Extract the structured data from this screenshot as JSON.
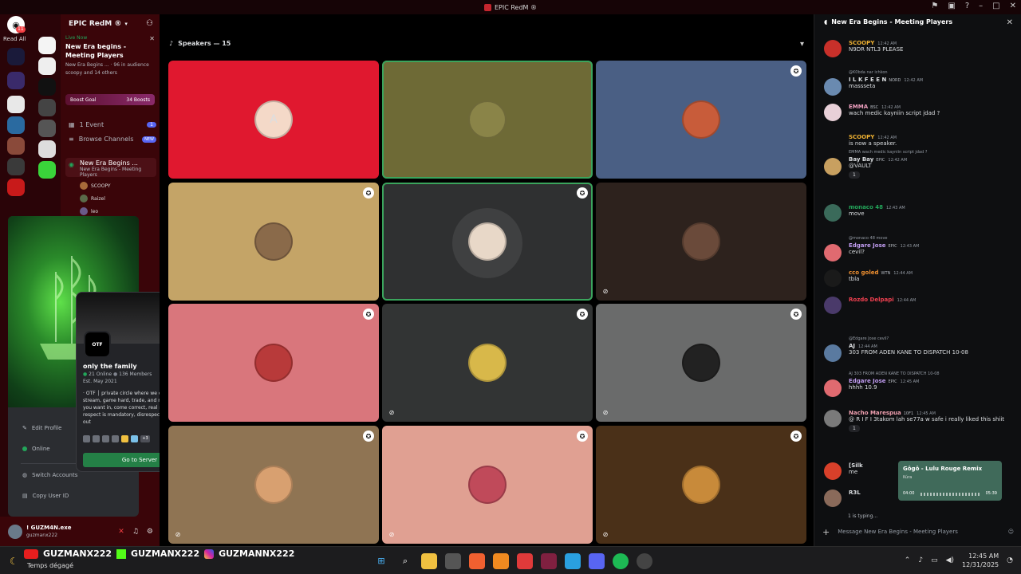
{
  "window": {
    "title": "EPIC RedM ®"
  },
  "guilds": {
    "read_all": "Read All",
    "dm_badge": "11"
  },
  "sidebar": {
    "server_name": "EPIC RedM ®",
    "live_label": "Live Now",
    "event_title": "New Era begins - Meeting Players",
    "event_sub": "New Era Begins ... · 96 in audience",
    "event_people": "scoopy and 14 others",
    "boost_goal": "Boost Goal",
    "boosts": "34 Boosts",
    "events_label": "1 Event",
    "events_count": "1",
    "browse_channels": "Browse Channels",
    "new_badge": "NEW",
    "stage_channel": "New Era Begins ...",
    "stage_channel_sub": "New Era Begins - Meeting Players",
    "members": [
      "SCOOPY",
      "Raizel",
      "leo"
    ]
  },
  "profile_menu": {
    "edit_profile": "Edit Profile",
    "online": "Online",
    "switch_accounts": "Switch Accounts",
    "copy_user_id": "Copy User ID"
  },
  "server_popup": {
    "icon_text": "OTF",
    "name": "only the family",
    "online": "21 Online",
    "members": "136 Members",
    "established": "Est. May 2021",
    "description": "· OTF │ private circle where we chill, grind, stream, game hard, trade, and move as one if you want in, come correct, real mindset only, respect is mandatory, disrespect once, you're out",
    "more_emojis": "+3",
    "go_button": "Go to Server"
  },
  "user": {
    "name": "! GUZM4N.exe",
    "tag": "guzmanx222"
  },
  "stage": {
    "speakers_label": "Speakers — 15"
  },
  "tiles": [
    {
      "color": "#e0182f",
      "avatar_color": "#f4d9c8",
      "mod": false,
      "muted": false,
      "speaking": false,
      "glyph": "A"
    },
    {
      "color": "#6e6a36",
      "avatar_color": "#8a8448",
      "mod": false,
      "muted": false,
      "speaking": true,
      "glyph": ""
    },
    {
      "color": "#4a5f84",
      "avatar_color": "#c85c3a",
      "mod": true,
      "muted": false,
      "speaking": false,
      "glyph": ""
    },
    {
      "color": "#c4a467",
      "avatar_color": "#8a6a4a",
      "mod": true,
      "muted": false,
      "speaking": false,
      "glyph": ""
    },
    {
      "color": "#2f3031",
      "avatar_color": "#e8d8c8",
      "mod": true,
      "muted": false,
      "speaking": true,
      "glyph": ""
    },
    {
      "color": "#2d221d",
      "avatar_color": "#6a4a3a",
      "mod": false,
      "muted": true,
      "speaking": false,
      "glyph": ""
    },
    {
      "color": "#d9767c",
      "avatar_color": "#b83a3a",
      "mod": true,
      "muted": false,
      "speaking": false,
      "glyph": ""
    },
    {
      "color": "#323434",
      "avatar_color": "#d8b84a",
      "mod": true,
      "muted": true,
      "speaking": false,
      "glyph": ""
    },
    {
      "color": "#6a6b6b",
      "avatar_color": "#222",
      "mod": true,
      "muted": true,
      "speaking": false,
      "glyph": ""
    },
    {
      "color": "#8f7453",
      "avatar_color": "#d8a070",
      "mod": true,
      "muted": true,
      "speaking": false,
      "glyph": ""
    },
    {
      "color": "#e0a092",
      "avatar_color": "#c04a5a",
      "mod": true,
      "muted": true,
      "speaking": false,
      "glyph": ""
    },
    {
      "color": "#4a3018",
      "avatar_color": "#c88a3a",
      "mod": true,
      "muted": true,
      "speaking": false,
      "glyph": ""
    }
  ],
  "chat": {
    "title": "New Era Begins - Meeting Players",
    "typing": "1 is typing...",
    "composer_placeholder": "Message New Era Begins - Meeting Players",
    "messages": [
      {
        "who": "SCOOPY",
        "time": "12:42 AM",
        "text": "N9DR NTL3 PLEASE",
        "ref": "",
        "tag": "",
        "react": "",
        "color": "#f0b232",
        "av": "#c8302a"
      },
      {
        "who": "I L K F E E N",
        "time": "12:42 AM",
        "text": "massseta",
        "ref": "@K0bda nar ichkon",
        "tag": "NORD",
        "react": "",
        "color": "#dbdee1",
        "av": "#6a8ab0"
      },
      {
        "who": "EMMA",
        "time": "12:42 AM",
        "text": "wach medic kayniin script jdad ?",
        "ref": "",
        "tag": "BSC",
        "react": "",
        "color": "#f0a0c0",
        "av": "#e8d0d8"
      },
      {
        "who": "SCOOPY",
        "time": "12:42 AM",
        "text": "is now a speaker.",
        "ref": "",
        "tag": "",
        "react": "",
        "color": "#f0b232",
        "av": ""
      },
      {
        "who": "Bay Bay",
        "time": "12:42 AM",
        "text": "@VAULT",
        "ref": "EMMA wach medic kayniin script jdad ?",
        "tag": "EPIC",
        "react": "1",
        "color": "#dbdee1",
        "av": "#c8a060"
      },
      {
        "who": "monaco 48",
        "time": "12:43 AM",
        "text": "move",
        "ref": "",
        "tag": "",
        "react": "",
        "color": "#23a55a",
        "av": "#3a6a5a"
      },
      {
        "who": "Edgare Jose",
        "time": "12:43 AM",
        "text": "cevil?",
        "ref": "@monaco 48 move",
        "tag": "EPIC",
        "react": "",
        "color": "#c09cf0",
        "av": "#e06a70"
      },
      {
        "who": "cco goled",
        "time": "12:44 AM",
        "text": "tbla",
        "ref": "",
        "tag": "WTN",
        "react": "",
        "color": "#f09030",
        "av": "#1a1a1a"
      },
      {
        "who": "Rozdo Delpapi",
        "time": "12:44 AM",
        "text": "",
        "ref": "",
        "tag": "",
        "react": "",
        "color": "#f04050",
        "av": "#4a3a6a"
      },
      {
        "who": "AJ",
        "time": "12:44 AM",
        "text": "303 FROM ADEN KANE TO DISPATCH 10-08",
        "ref": "@Edgare Jose cevil?",
        "tag": "",
        "react": "",
        "color": "#dbdee1",
        "av": "#5a7aa0"
      },
      {
        "who": "Edgare Jose",
        "time": "12:45 AM",
        "text": "hhhh 10.9",
        "ref": "AJ 303 FROM ADEN KANE TO DISPATCH 10-08",
        "tag": "EPIC",
        "react": "",
        "color": "#c09cf0",
        "av": "#e06a70"
      },
      {
        "who": "Nacho Marespua",
        "time": "12:45 AM",
        "text": "@ R I F I 3takom lah se77a w safe i really liked this shiit",
        "ref": "",
        "tag": "10F1",
        "react": "1",
        "color": "#f0a0b0",
        "av": "#7a7a7a"
      },
      {
        "who": "[Silk",
        "time": "",
        "text": "me",
        "ref": "",
        "tag": "",
        "react": "",
        "color": "#dbdee1",
        "av": "#d8402a"
      },
      {
        "who": "R3L",
        "time": "",
        "text": "",
        "ref": "",
        "tag": "",
        "react": "",
        "color": "#dbdee1",
        "av": "#8a6a5a"
      }
    ]
  },
  "spotify": {
    "title": "Gôgô - Lulu Rouge Remix",
    "artist": "Kúra",
    "elapsed": "04:00",
    "total": "05:39"
  },
  "taskbar": {
    "socials": [
      "GUZMANX222",
      "GUZMANX222",
      "GUZMANNX222"
    ],
    "weather": "Temps dégagé",
    "time": "12:45 AM",
    "date": "12/31/2025"
  }
}
